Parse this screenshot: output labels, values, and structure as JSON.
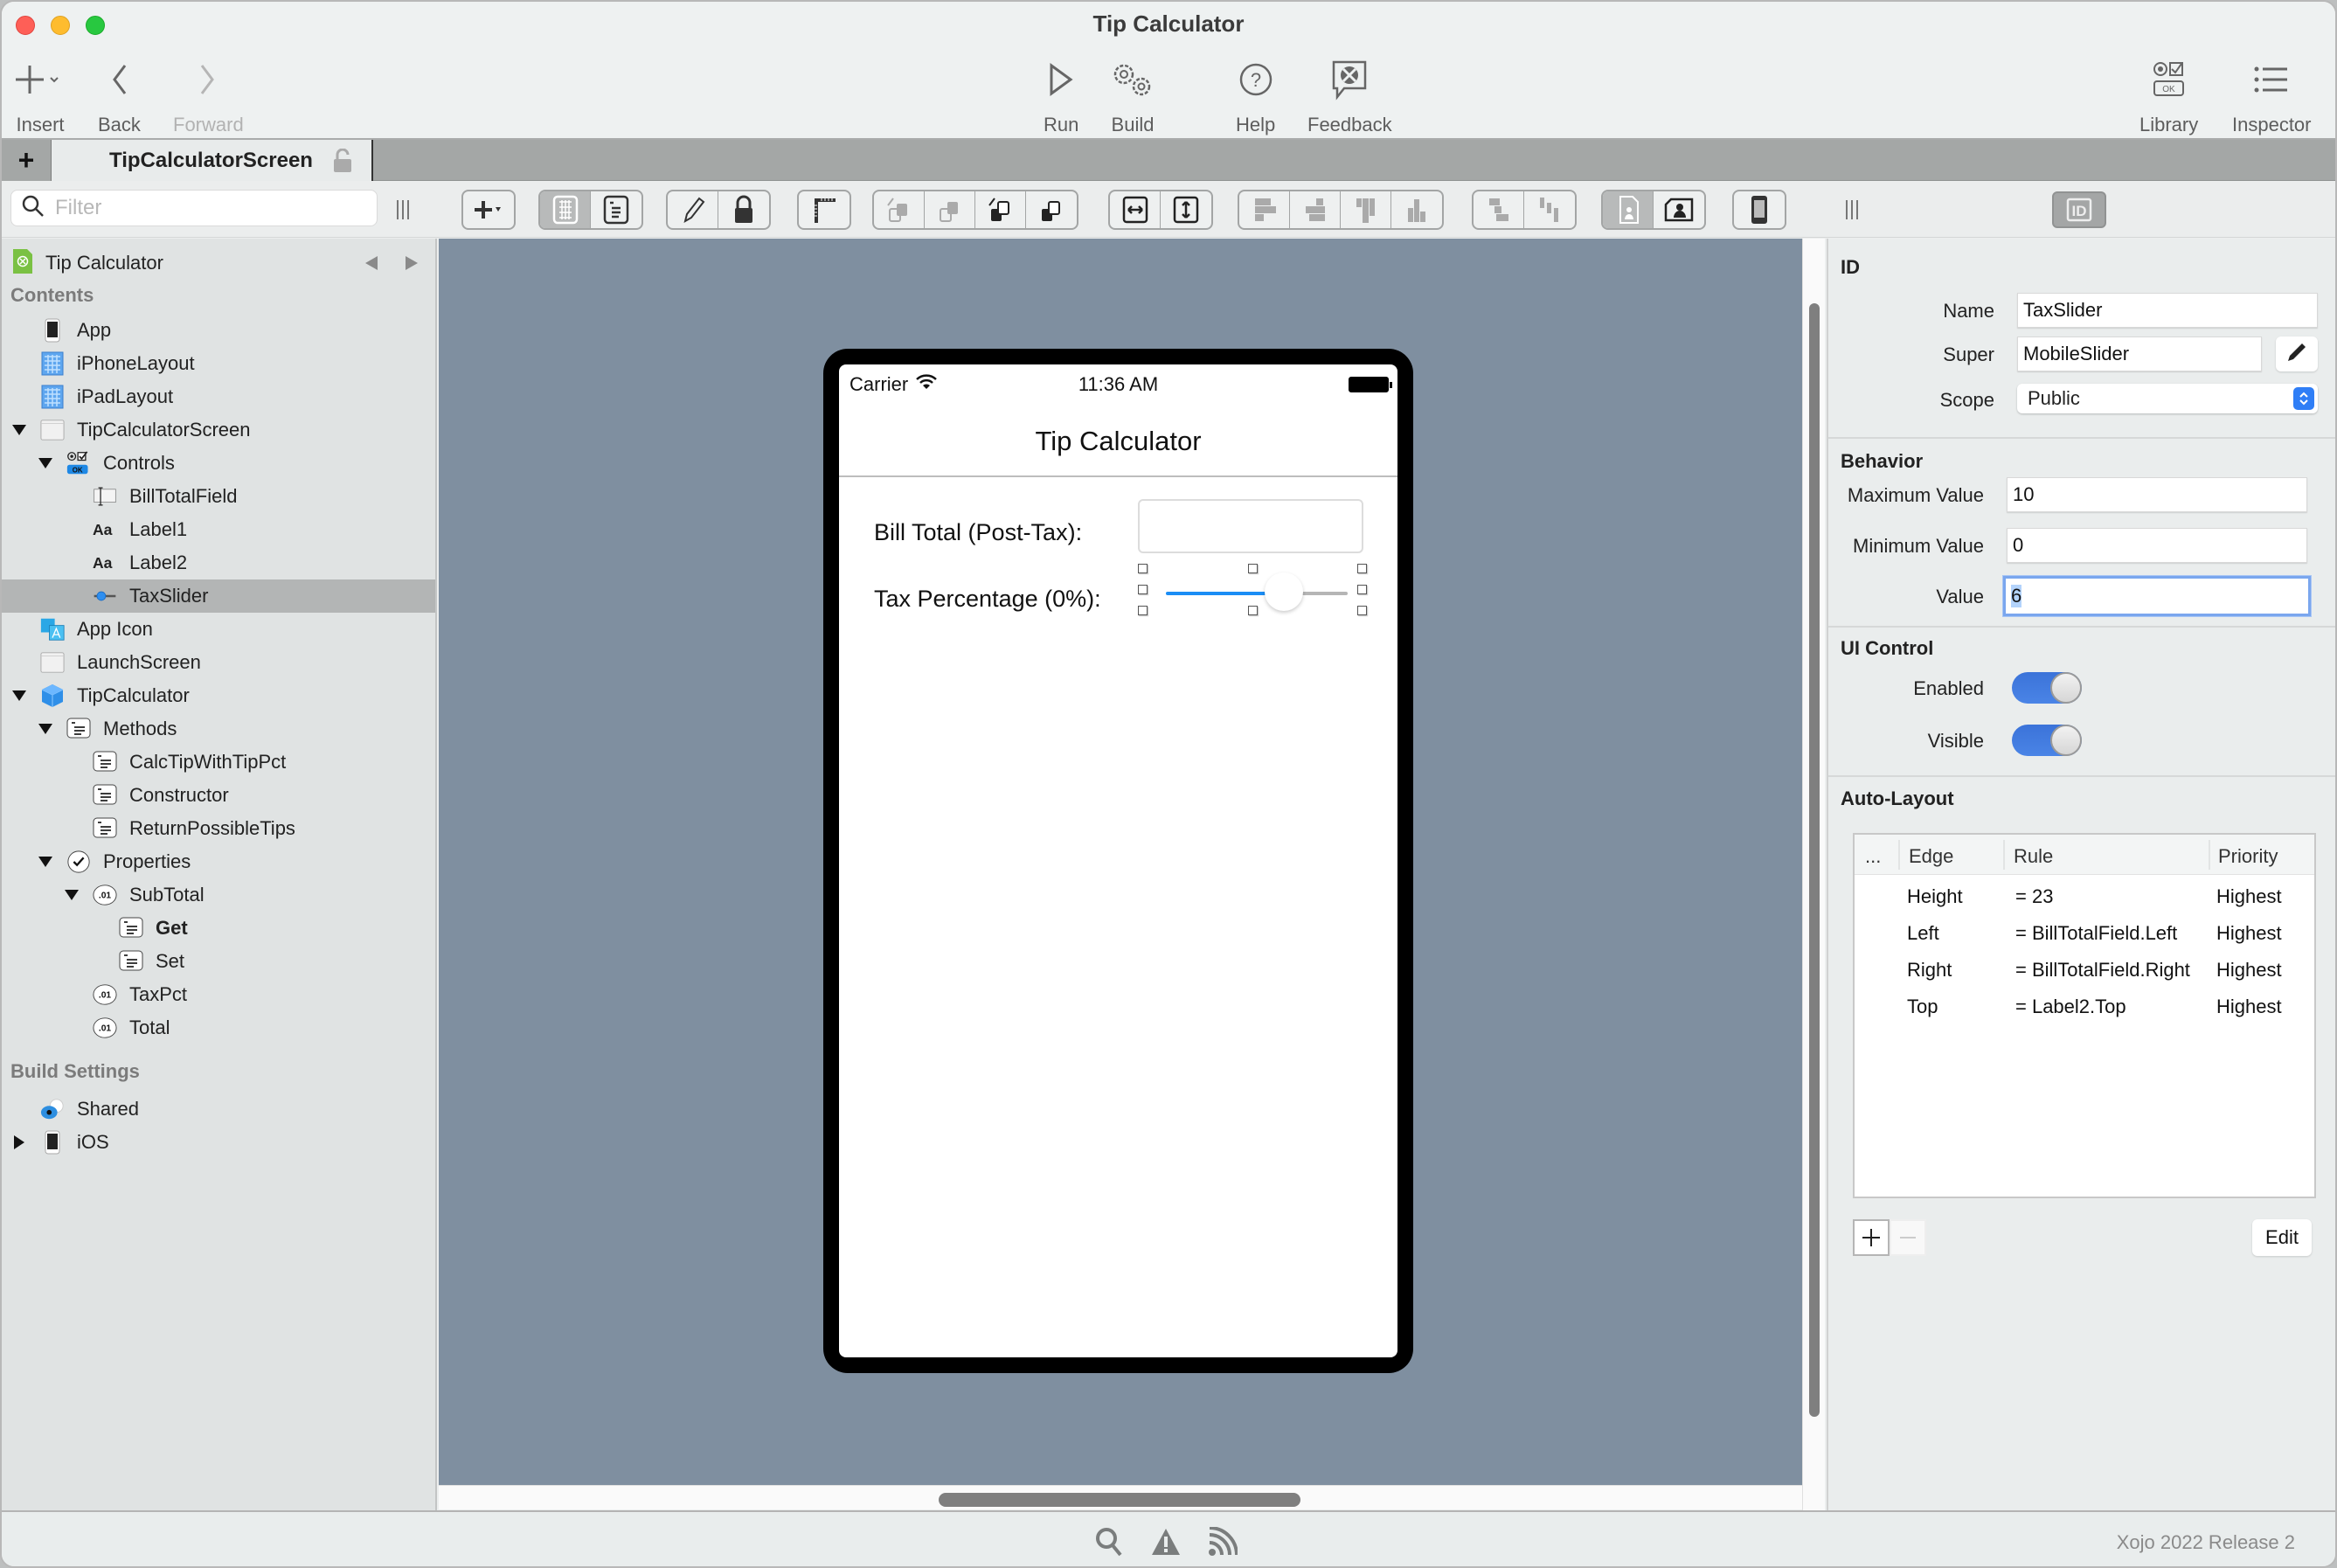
{
  "window": {
    "title": "Tip Calculator"
  },
  "toolbar": {
    "insert": "Insert",
    "back": "Back",
    "forward": "Forward",
    "run": "Run",
    "build": "Build",
    "help": "Help",
    "feedback": "Feedback",
    "library": "Library",
    "inspector": "Inspector"
  },
  "tabs": [
    {
      "label": "TipCalculatorScreen",
      "active": true,
      "locked": false
    }
  ],
  "filter": {
    "placeholder": "Filter",
    "value": ""
  },
  "navigator": {
    "project_name": "Tip Calculator",
    "sections": {
      "contents": "Contents",
      "build_settings": "Build Settings"
    },
    "items": [
      {
        "label": "App",
        "icon": "iphone-icon",
        "level": 0,
        "disclosure": "none"
      },
      {
        "label": "iPhoneLayout",
        "icon": "layout-grid-icon",
        "level": 0,
        "disclosure": "none"
      },
      {
        "label": "iPadLayout",
        "icon": "layout-grid-icon",
        "level": 0,
        "disclosure": "none"
      },
      {
        "label": "TipCalculatorScreen",
        "icon": "screen-icon",
        "level": 0,
        "disclosure": "expanded"
      },
      {
        "label": "Controls",
        "icon": "controls-icon",
        "level": 1,
        "disclosure": "expanded"
      },
      {
        "label": "BillTotalField",
        "icon": "text-field-icon",
        "level": 2,
        "disclosure": "none"
      },
      {
        "label": "Label1",
        "icon": "label-icon",
        "level": 2,
        "disclosure": "none"
      },
      {
        "label": "Label2",
        "icon": "label-icon",
        "level": 2,
        "disclosure": "none"
      },
      {
        "label": "TaxSlider",
        "icon": "slider-icon",
        "level": 2,
        "disclosure": "none",
        "selected": true
      },
      {
        "label": "App Icon",
        "icon": "app-icon-icon",
        "level": 0,
        "disclosure": "none"
      },
      {
        "label": "LaunchScreen",
        "icon": "screen-icon",
        "level": 0,
        "disclosure": "none"
      },
      {
        "label": "TipCalculator",
        "icon": "class-cube-icon",
        "level": 0,
        "disclosure": "expanded"
      },
      {
        "label": "Methods",
        "icon": "method-icon",
        "level": 1,
        "disclosure": "expanded"
      },
      {
        "label": "CalcTipWithTipPct",
        "icon": "method-icon",
        "level": 2,
        "disclosure": "none"
      },
      {
        "label": "Constructor",
        "icon": "method-icon",
        "level": 2,
        "disclosure": "none"
      },
      {
        "label": "ReturnPossibleTips",
        "icon": "method-icon",
        "level": 2,
        "disclosure": "none"
      },
      {
        "label": "Properties",
        "icon": "properties-check-icon",
        "level": 1,
        "disclosure": "expanded"
      },
      {
        "label": "SubTotal",
        "icon": "property-icon",
        "level": 2,
        "disclosure": "expanded"
      },
      {
        "label": "Get",
        "icon": "method-icon",
        "level": 3,
        "disclosure": "none",
        "bold": true
      },
      {
        "label": "Set",
        "icon": "method-icon",
        "level": 3,
        "disclosure": "none"
      },
      {
        "label": "TaxPct",
        "icon": "property-icon",
        "level": 2,
        "disclosure": "none"
      },
      {
        "label": "Total",
        "icon": "property-icon",
        "level": 2,
        "disclosure": "none"
      }
    ],
    "build_items": [
      {
        "label": "Shared",
        "icon": "shared-icon",
        "level": 0,
        "disclosure": "none"
      },
      {
        "label": "iOS",
        "icon": "iphone-icon",
        "level": 0,
        "disclosure": "collapsed"
      }
    ]
  },
  "phone": {
    "carrier": "Carrier",
    "time": "11:36 AM",
    "nav_title": "Tip Calculator",
    "bill_label": "Bill Total (Post-Tax):",
    "bill_value": "",
    "tax_label": "Tax Percentage (0%):",
    "slider": {
      "min": 0,
      "max": 10,
      "value": 6
    },
    "accent": "#1b8df5"
  },
  "inspector": {
    "id": {
      "title": "ID",
      "name_label": "Name",
      "name_value": "TaxSlider",
      "super_label": "Super",
      "super_value": "MobileSlider",
      "scope_label": "Scope",
      "scope_value": "Public"
    },
    "behavior": {
      "title": "Behavior",
      "max_label": "Maximum Value",
      "max_value": "10",
      "min_label": "Minimum Value",
      "min_value": "0",
      "value_label": "Value",
      "value_value": "6"
    },
    "ui_control": {
      "title": "UI Control",
      "enabled_label": "Enabled",
      "enabled": true,
      "visible_label": "Visible",
      "visible": true
    },
    "auto_layout": {
      "title": "Auto-Layout",
      "columns": [
        "...",
        "Edge",
        "Rule",
        "Priority"
      ],
      "rows": [
        {
          "edge": "Height",
          "rule": "=  23",
          "priority": "Highest"
        },
        {
          "edge": "Left",
          "rule": "= BillTotalField.Left",
          "priority": "Highest"
        },
        {
          "edge": "Right",
          "rule": "= BillTotalField.Right",
          "priority": "Highest"
        },
        {
          "edge": "Top",
          "rule": "= Label2.Top",
          "priority": "Highest"
        }
      ],
      "edit_label": "Edit"
    }
  },
  "statusbar": {
    "version": "Xojo 2022 Release 2"
  }
}
